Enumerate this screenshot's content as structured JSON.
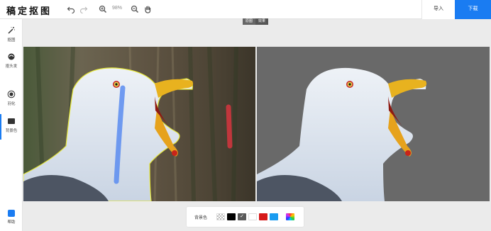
{
  "app": {
    "logo_text": "稿定抠图"
  },
  "toolbar": {
    "zoom_value": "98%",
    "import_label": "导入",
    "download_label": "下载",
    "icons": [
      "undo-icon",
      "redo-icon",
      "zoom-in-icon",
      "zoom-out-icon",
      "hand-icon"
    ]
  },
  "sidebar": {
    "items": [
      {
        "label": "抠图",
        "icon": "magic-wand-icon"
      },
      {
        "label": "抠头发",
        "icon": "hair-icon"
      },
      {
        "label": "羽化",
        "icon": "feather-icon"
      },
      {
        "label": "背景色",
        "icon": "background-icon"
      }
    ],
    "help_label": "帮助"
  },
  "view_toggle": {
    "left": "原图",
    "right": "效果"
  },
  "bg_colors": {
    "label": "背景色",
    "swatches": [
      "transparent",
      "#000000",
      "#5a5a5a",
      "#ffffff",
      "#d61a1a",
      "#1a9cf0",
      "rainbow"
    ],
    "selected": "#5a5a5a"
  },
  "colors": {
    "accent": "#1a7cf2",
    "preview_bg": "#696969"
  }
}
